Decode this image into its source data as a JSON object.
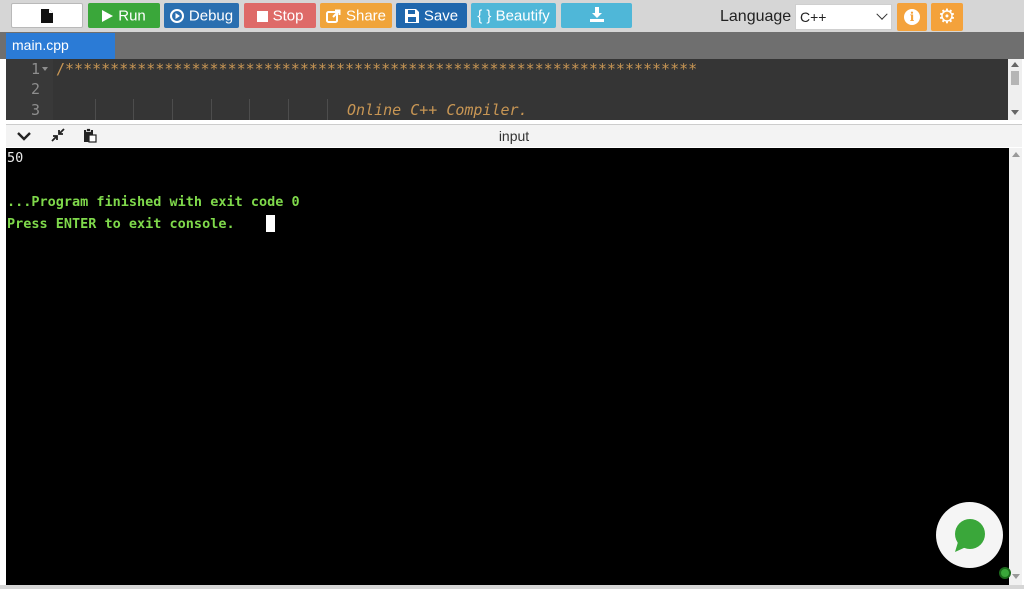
{
  "toolbar": {
    "run_label": "Run",
    "debug_label": "Debug",
    "stop_label": "Stop",
    "share_label": "Share",
    "save_label": "Save",
    "beautify_label": "{ } Beautify",
    "language_label": "Language",
    "language_value": "C++",
    "colors": {
      "run": "#3aa73a",
      "debug": "#2a6fb0",
      "stop": "#de6a68",
      "share": "#f0a43a",
      "save": "#1f67ad",
      "beautify": "#4fb7d8",
      "info": "#f4a23b"
    },
    "icons": {
      "new_file": "file-icon",
      "run": "play-icon",
      "debug": "debug-circle-icon",
      "stop": "stop-square-icon",
      "share": "share-icon",
      "save": "floppy-icon",
      "download": "download-icon",
      "info": "info-icon",
      "settings": "gear-icon"
    }
  },
  "tabs": [
    {
      "label": "main.cpp",
      "active": true
    }
  ],
  "editor": {
    "line_numbers": [
      "1",
      "2",
      "3"
    ],
    "lines": [
      "/**********************************************************************",
      "",
      "Online C++ Compiler."
    ]
  },
  "io_panel": {
    "title": "input",
    "icons": [
      "chevron-down-icon",
      "compress-icon",
      "paste-icon"
    ]
  },
  "console": {
    "output": "50",
    "finished": "...Program finished with exit code 0",
    "prompt": "Press ENTER to exit console."
  },
  "chat": {
    "icon": "chat-bubble-icon",
    "color": "#3aa73a"
  }
}
